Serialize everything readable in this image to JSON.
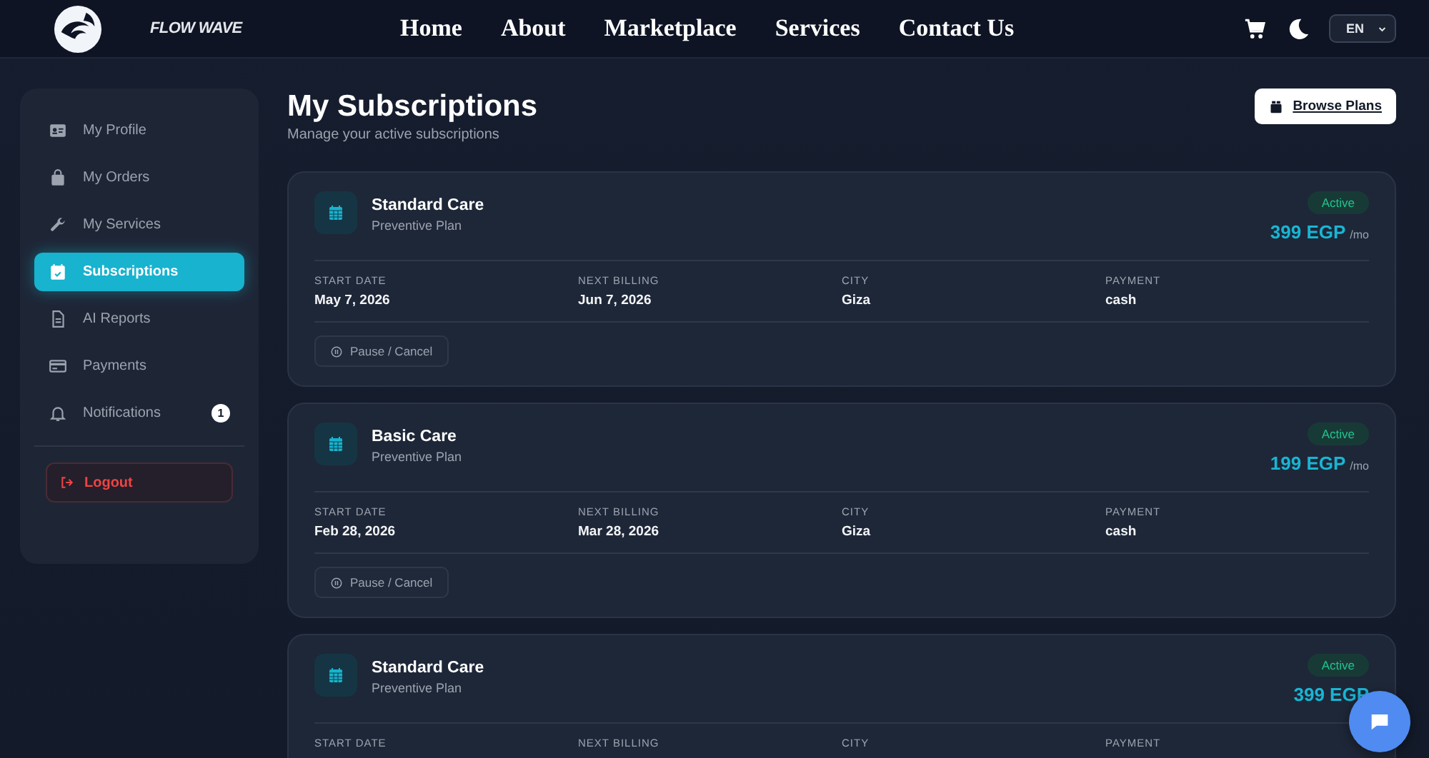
{
  "header": {
    "brand": "FLOW WAVE",
    "nav": [
      {
        "label": "Home"
      },
      {
        "label": "About"
      },
      {
        "label": "Marketplace"
      },
      {
        "label": "Services"
      },
      {
        "label": "Contact Us"
      }
    ],
    "language": "EN"
  },
  "sidebar": {
    "items": [
      {
        "label": "My Profile",
        "selected": false
      },
      {
        "label": "My Orders",
        "selected": false
      },
      {
        "label": "My Services",
        "selected": false
      },
      {
        "label": "Subscriptions",
        "selected": true
      },
      {
        "label": "AI Reports",
        "selected": false
      },
      {
        "label": "Payments",
        "selected": false
      },
      {
        "label": "Notifications",
        "selected": false,
        "badge": "1"
      }
    ],
    "logout": "Logout"
  },
  "page": {
    "title": "My Subscriptions",
    "subtitle": "Manage your active subscriptions",
    "browse_button": "Browse Plans"
  },
  "subscriptions": [
    {
      "name": "Standard Care",
      "plan": "Preventive Plan",
      "status": "Active",
      "price": "399 EGP",
      "period": "/mo",
      "details": [
        {
          "label": "START DATE",
          "value": "May 7, 2026"
        },
        {
          "label": "NEXT BILLING",
          "value": "Jun 7, 2026"
        },
        {
          "label": "CITY",
          "value": "Giza"
        },
        {
          "label": "PAYMENT",
          "value": "cash"
        }
      ],
      "action": "Pause / Cancel"
    },
    {
      "name": "Basic Care",
      "plan": "Preventive Plan",
      "status": "Active",
      "price": "199 EGP",
      "period": "/mo",
      "details": [
        {
          "label": "START DATE",
          "value": "Feb 28, 2026"
        },
        {
          "label": "NEXT BILLING",
          "value": "Mar 28, 2026"
        },
        {
          "label": "CITY",
          "value": "Giza"
        },
        {
          "label": "PAYMENT",
          "value": "cash"
        }
      ],
      "action": "Pause / Cancel"
    },
    {
      "name": "Standard Care",
      "plan": "Preventive Plan",
      "status": "Active",
      "price": "399 EGP",
      "details": [
        {
          "label": "START DATE"
        },
        {
          "label": "NEXT BILLING"
        },
        {
          "label": "CITY"
        },
        {
          "label": "PAYMENT"
        }
      ]
    }
  ]
}
